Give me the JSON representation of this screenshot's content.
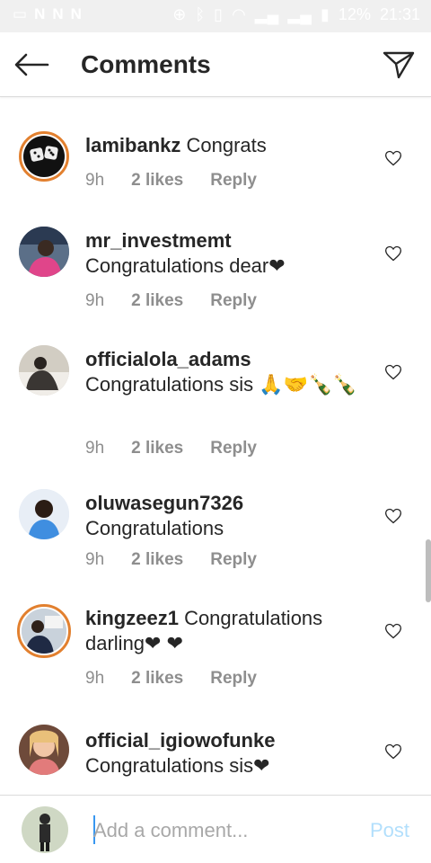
{
  "status_bar": {
    "battery": "12%",
    "time": "21:31"
  },
  "header": {
    "title": "Comments"
  },
  "comments": [
    {
      "username": "lamibankz",
      "text": "Congrats",
      "time": "9h",
      "likes": "2 likes",
      "reply": "Reply"
    },
    {
      "username": "mr_investmemt",
      "text": "Congratulations dear❤",
      "time": "9h",
      "likes": "2 likes",
      "reply": "Reply"
    },
    {
      "username": "officialola_adams",
      "text": "Congratulations sis 🙏🤝🍾🍾",
      "time": "9h",
      "likes": "2 likes",
      "reply": "Reply"
    },
    {
      "username": "oluwasegun7326",
      "text": "Congratulations",
      "time": "9h",
      "likes": "2 likes",
      "reply": "Reply"
    },
    {
      "username": "kingzeez1",
      "text": "Congratulations darling❤ ❤",
      "time": "9h",
      "likes": "2 likes",
      "reply": "Reply"
    },
    {
      "username": "official_igiowofunke",
      "text": "Congratulations sis❤"
    }
  ],
  "composer": {
    "placeholder": "Add a comment...",
    "post_label": "Post"
  },
  "icons": {
    "back": "arrow-left-icon",
    "send": "paper-plane-icon",
    "like": "heart-outline-icon"
  },
  "colors": {
    "text": "#262626",
    "muted": "#8e8e8e",
    "post_disabled": "#b2dffc",
    "caret": "#3897f0",
    "heart": "#e1306c"
  }
}
